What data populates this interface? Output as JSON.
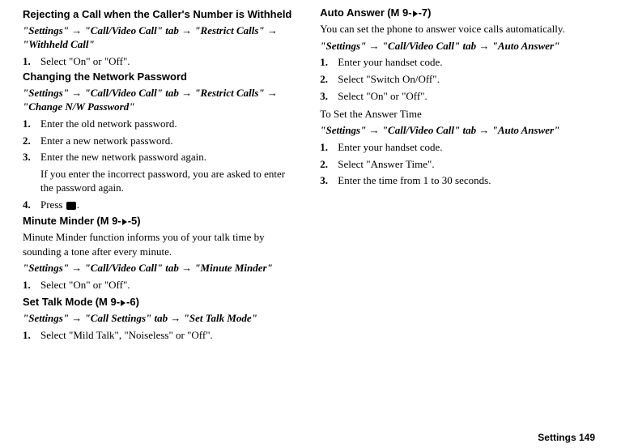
{
  "left": {
    "rejecting": {
      "title": "Rejecting a Call when the Caller's Number is Withheld",
      "path": "\"Settings\" → \"Call/Video Call\" tab → \"Restrict Calls\" → \"Withheld Call\"",
      "steps": [
        "Select \"On\" or \"Off\"."
      ]
    },
    "changing": {
      "title": "Changing the Network Password",
      "path": "\"Settings\" → \"Call/Video Call\" tab → \"Restrict Calls\" → \"Change N/W Password\"",
      "steps": [
        "Enter the old network password.",
        "Enter a new network password.",
        "Enter the new network password again.",
        "Press "
      ],
      "note": "If you enter the incorrect password, you are asked to enter the password again.",
      "step4_suffix": "."
    },
    "minute": {
      "title": "Minute Minder",
      "code_pre": " (M 9-",
      "code_post": "-5)",
      "desc": "Minute Minder function informs you of your talk time by sounding a tone after every minute.",
      "path": "\"Settings\" → \"Call/Video Call\" tab → \"Minute Minder\"",
      "steps": [
        "Select \"On\" or \"Off\"."
      ]
    },
    "talk": {
      "title": "Set Talk Mode",
      "code_pre": " (M 9-",
      "code_post": "-6)",
      "path": "\"Settings\" → \"Call Settings\" tab → \"Set Talk Mode\"",
      "steps": [
        "Select \"Mild Talk\", \"Noiseless\" or \"Off\"."
      ]
    }
  },
  "right": {
    "auto": {
      "title": "Auto Answer",
      "code_pre": " (M 9-",
      "code_post": "-7)",
      "desc": "You can set the phone to answer voice calls automatically.",
      "path": "\"Settings\" → \"Call/Video Call\" tab → \"Auto Answer\"",
      "steps": [
        "Enter your handset code.",
        "Select \"Switch On/Off\".",
        "Select \"On\" or \"Off\"."
      ]
    },
    "answer_time": {
      "title": "To Set the Answer Time",
      "path": "\"Settings\" → \"Call/Video Call\" tab → \"Auto Answer\"",
      "steps": [
        "Enter your handset code.",
        "Select \"Answer Time\".",
        "Enter the time from 1 to 30 seconds."
      ]
    }
  },
  "footer": "Settings   149"
}
